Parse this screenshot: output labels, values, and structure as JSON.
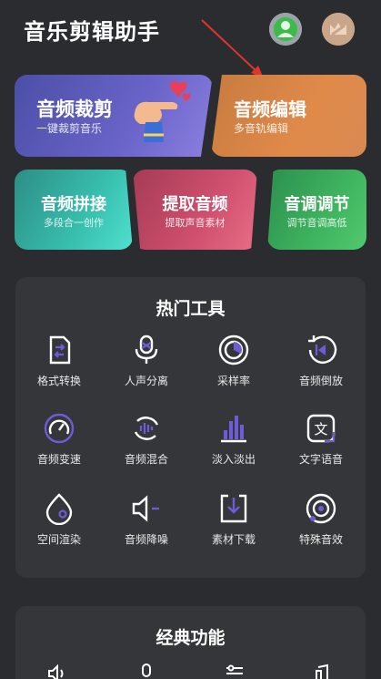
{
  "header": {
    "title": "音乐剪辑助手"
  },
  "cards": {
    "trim": {
      "title": "音频裁剪",
      "sub": "一键裁剪音乐"
    },
    "edit": {
      "title": "音频编辑",
      "sub": "多音轨编辑"
    },
    "splice": {
      "title": "音频拼接",
      "sub": "多段合一创作"
    },
    "extract": {
      "title": "提取音频",
      "sub": "提取声音素材"
    },
    "tone": {
      "title": "音调调节",
      "sub": "调节音调高低"
    }
  },
  "hot_tools": {
    "title": "热门工具",
    "items": [
      {
        "label": "格式转换",
        "icon": "format-convert-icon"
      },
      {
        "label": "人声分离",
        "icon": "vocal-separate-icon"
      },
      {
        "label": "采样率",
        "icon": "sample-rate-icon"
      },
      {
        "label": "音频倒放",
        "icon": "reverse-icon"
      },
      {
        "label": "音频变速",
        "icon": "speed-icon"
      },
      {
        "label": "音频混合",
        "icon": "mix-icon"
      },
      {
        "label": "淡入淡出",
        "icon": "fade-icon"
      },
      {
        "label": "文字语音",
        "icon": "text-to-speech-icon"
      },
      {
        "label": "空间渲染",
        "icon": "spatial-icon"
      },
      {
        "label": "音频降噪",
        "icon": "denoise-icon"
      },
      {
        "label": "素材下载",
        "icon": "download-icon"
      },
      {
        "label": "特殊音效",
        "icon": "special-effect-icon"
      }
    ]
  },
  "classic": {
    "title": "经典功能"
  },
  "colors": {
    "accent": "#6f5bd8",
    "background": "#2b2c30",
    "panel": "#353639",
    "arrow": "#e0352b"
  }
}
